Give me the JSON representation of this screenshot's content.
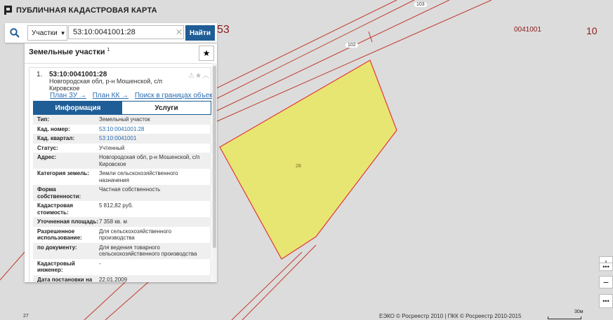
{
  "app": {
    "title": "ПУБЛИЧНАЯ КАДАСТРОВАЯ КАРТА"
  },
  "search": {
    "type_label": "Участки",
    "value": "53:10:0041001:28",
    "find_label": "Найти"
  },
  "panel": {
    "title": "Земельные участки",
    "count": "1",
    "result": {
      "index": "1.",
      "cad_number": "53:10:0041001:28",
      "address": "Новгородская обл, р-н Мошенской, с/п Кировское",
      "links": [
        "План ЗУ →",
        "План КК →",
        "Поиск в границах объекта →"
      ],
      "tabs": [
        "Информация",
        "Услуги"
      ],
      "rows": [
        {
          "k": "Тип:",
          "v": "Земельный участок"
        },
        {
          "k": "Кад. номер:",
          "v": "53:10:0041001:28"
        },
        {
          "k": "Кад. квартал:",
          "v": "53:10:0041001"
        },
        {
          "k": "Статус:",
          "v": "Учтенный"
        },
        {
          "k": "Адрес:",
          "v": "Новгородская обл, р-н Мошенской, с/п Кировское"
        },
        {
          "k": "Категория земель:",
          "v": "Земли сельскохозяйственного назначения"
        },
        {
          "k": "Форма собственности:",
          "v": "Частная собственность"
        },
        {
          "k": "Кадастровая стоимость:",
          "v": "5 812,82 руб."
        },
        {
          "k": "Уточненная площадь:",
          "v": "7 358 кв. м"
        },
        {
          "k": "Разрешенное использование:",
          "v": "Для сельскохозяйственного производства"
        },
        {
          "k": "по документу:",
          "v": "Для ведения товарного сельскохозяйственного производства"
        },
        {
          "k": "Кадастровый инженер:",
          "v": "-"
        },
        {
          "k": "Дата постановки на учет:",
          "v": "22.01.2009"
        }
      ]
    }
  },
  "map": {
    "labels": {
      "q53": "53",
      "q0041001": "0041001",
      "q10": "10",
      "r103": "103",
      "r102": "102",
      "p28": "28",
      "p27": "27"
    },
    "colors": {
      "parcel_fill": "#e8e672",
      "parcel_stroke": "#e0383c",
      "boundary": "#c0392b"
    }
  },
  "controls": {
    "zoom_in": "+",
    "zoom_out": "−",
    "more": "•••",
    "more2": "•••"
  },
  "footer": {
    "copyright": "ЕЭКО © Росреестр 2010 | ПКК © Росреестр 2010-2015",
    "scale": "30м"
  }
}
